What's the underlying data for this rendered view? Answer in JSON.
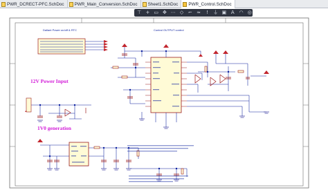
{
  "tabs": [
    {
      "label": "PWR_DCRECT-PFC.SchDoc",
      "active": false
    },
    {
      "label": "PWR_Main_Conversion.SchDoc",
      "active": false
    },
    {
      "label": "Sheet1.SchDoc",
      "active": false
    },
    {
      "label": "PWR_Control.SchDoc",
      "active": true
    }
  ],
  "toolbar_icons": [
    "filter-icon",
    "add-icon",
    "rectangle-select-icon",
    "move-icon",
    "align-icon",
    "port-icon",
    "wire-icon",
    "bus-icon",
    "net-label-icon",
    "power-port-icon",
    "place-part-icon",
    "text-icon",
    "arc-icon",
    "highlight-icon"
  ],
  "toolbar_glyphs": [
    "⊤",
    "+",
    "▭",
    "✥",
    "⋯",
    "◇",
    "⌐",
    "≈",
    "ǃ",
    "⏚",
    "▣",
    "A",
    "◠",
    "◎"
  ],
  "schematic": {
    "section_12v": "12V Power Input",
    "section_1v0": "1V0 generation",
    "block_title_left": "Dallant Power on/off & RTC",
    "block_title_right": "Control OUTPUT control"
  },
  "colors": {
    "wire": "#0a1f9e",
    "component": "#9b1c1c",
    "component_fill": "#fffbd6",
    "heading": "#d21bd8",
    "power_port": "#c2262e",
    "border": "#6d6d6d"
  }
}
